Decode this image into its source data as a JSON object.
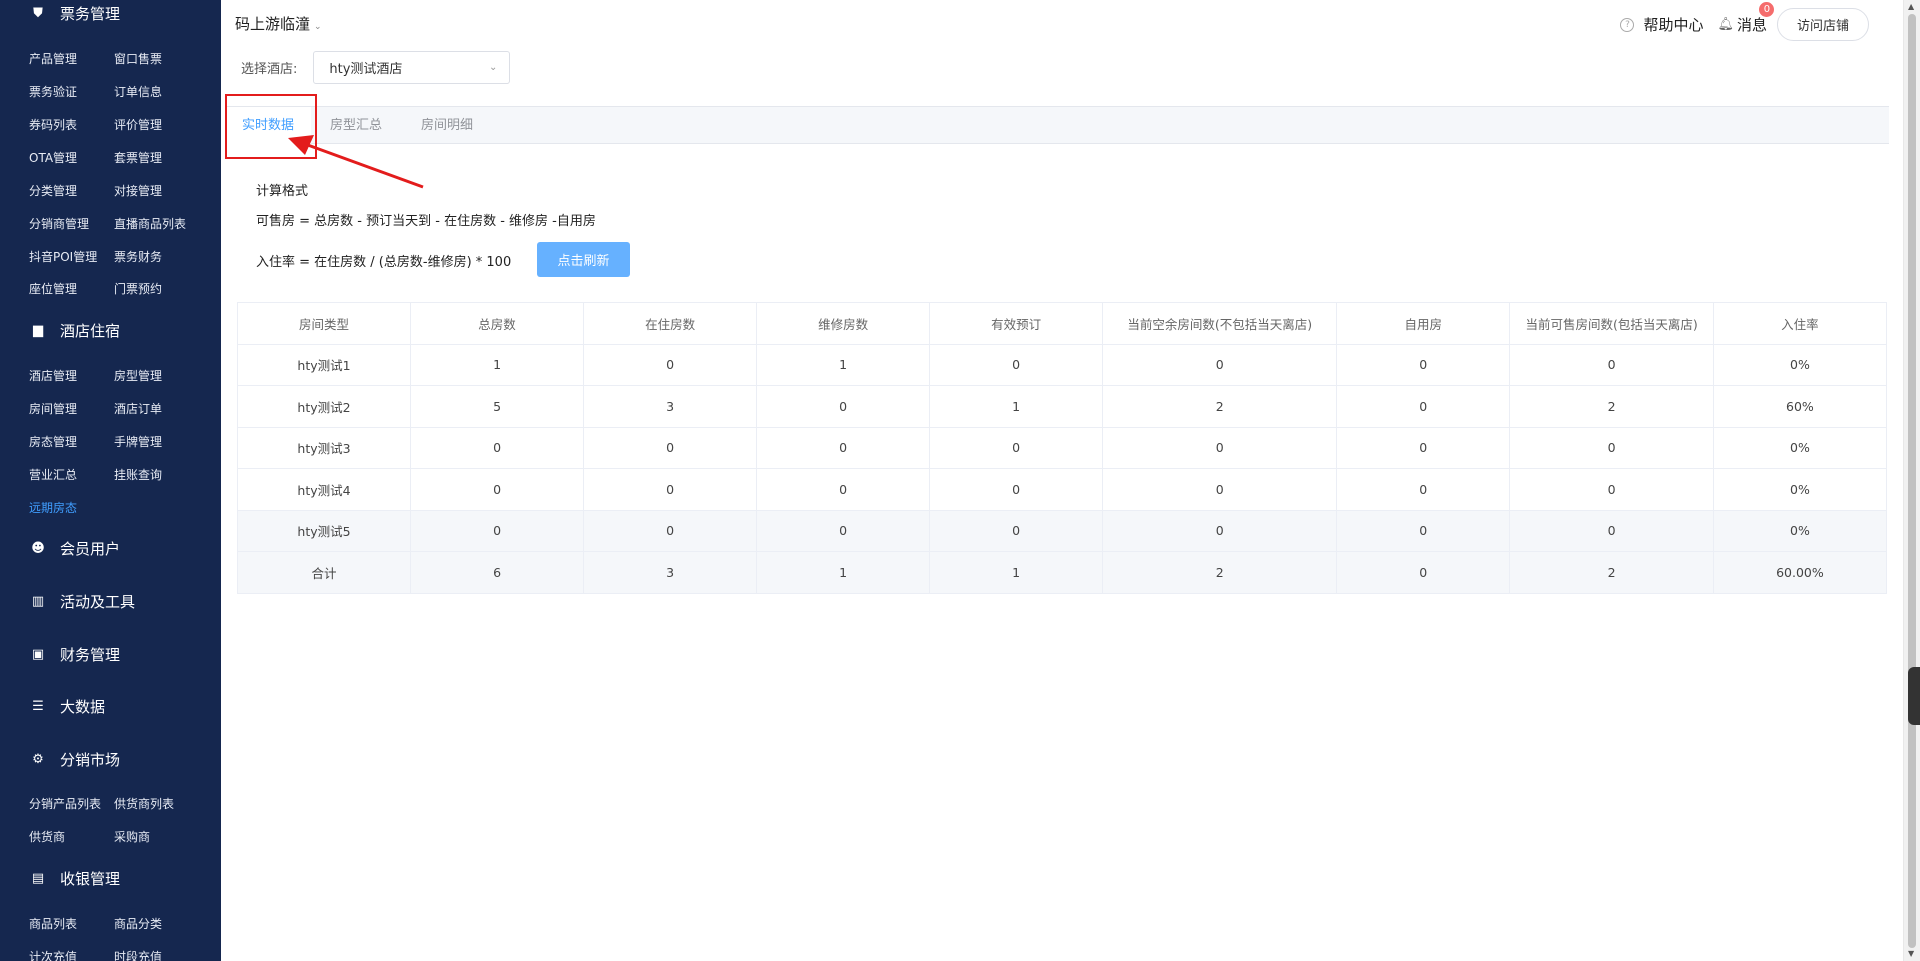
{
  "sidebar": {
    "groups": [
      {
        "label": "票务管理",
        "icon": "ticket-icon",
        "glyph": "⛊"
      },
      {
        "label": "酒店住宿",
        "icon": "hotel-icon",
        "glyph": "▆"
      },
      {
        "label": "会员用户",
        "icon": "users-icon",
        "glyph": "☻"
      },
      {
        "label": "活动及工具",
        "icon": "chart-icon",
        "glyph": "▥"
      },
      {
        "label": "财务管理",
        "icon": "wallet-icon",
        "glyph": "▣"
      },
      {
        "label": "大数据",
        "icon": "list-icon",
        "glyph": "☰"
      },
      {
        "label": "分销市场",
        "icon": "share-icon",
        "glyph": "⚙"
      },
      {
        "label": "收银管理",
        "icon": "cashier-icon",
        "glyph": "▤"
      }
    ],
    "ticket_items": [
      "产品管理",
      "窗口售票",
      "票务验证",
      "订单信息",
      "券码列表",
      "评价管理",
      "OTA管理",
      "套票管理",
      "分类管理",
      "对接管理",
      "分销商管理",
      "直播商品列表",
      "抖音POI管理",
      "票务财务",
      "座位管理",
      "门票预约"
    ],
    "hotel_items": [
      "酒店管理",
      "房型管理",
      "房间管理",
      "酒店订单",
      "房态管理",
      "手牌管理",
      "营业汇总",
      "挂账查询",
      "远期房态"
    ],
    "distribution_items": [
      "分销产品列表",
      "供货商列表",
      "供货商",
      "采购商"
    ],
    "cashier_items": [
      "商品列表",
      "商品分类",
      "计次充值",
      "时段充值"
    ]
  },
  "header": {
    "store_name": "码上游临潼",
    "help_label": "帮助中心",
    "message_label": "消息",
    "message_count": "0",
    "visit_label": "访问店铺"
  },
  "hotel_select": {
    "label": "选择酒店:",
    "value": "hty测试酒店"
  },
  "tabs": [
    "实时数据",
    "房型汇总",
    "房间明细"
  ],
  "formula": {
    "title": "计算格式",
    "line1": "可售房 = 总房数 - 预订当天到 - 在住房数 - 维修房 -自用房",
    "line2": "入住率 = 在住房数 / (总房数-维修房) * 100",
    "refresh_label": "点击刷新"
  },
  "table": {
    "headers": [
      "房间类型",
      "总房数",
      "在住房数",
      "维修房数",
      "有效预订",
      "当前空余房间数(不包括当天离店)",
      "自用房",
      "当前可售房间数(包括当天离店)",
      "入住率"
    ],
    "rows": [
      [
        "hty测试1",
        "1",
        "0",
        "1",
        "0",
        "0",
        "0",
        "0",
        "0%"
      ],
      [
        "hty测试2",
        "5",
        "3",
        "0",
        "1",
        "2",
        "0",
        "2",
        "60%"
      ],
      [
        "hty测试3",
        "0",
        "0",
        "0",
        "0",
        "0",
        "0",
        "0",
        "0%"
      ],
      [
        "hty测试4",
        "0",
        "0",
        "0",
        "0",
        "0",
        "0",
        "0",
        "0%"
      ],
      [
        "hty测试5",
        "0",
        "0",
        "0",
        "0",
        "0",
        "0",
        "0",
        "0%"
      ],
      [
        "合计",
        "6",
        "3",
        "1",
        "1",
        "2",
        "0",
        "2",
        "60.00%"
      ]
    ]
  },
  "colors": {
    "sidebar_bg": "#15274f",
    "accent": "#409eff",
    "refresh_button": "#66b1ff",
    "annotation_red": "#e31c1c",
    "badge_red": "#f56c6c"
  }
}
